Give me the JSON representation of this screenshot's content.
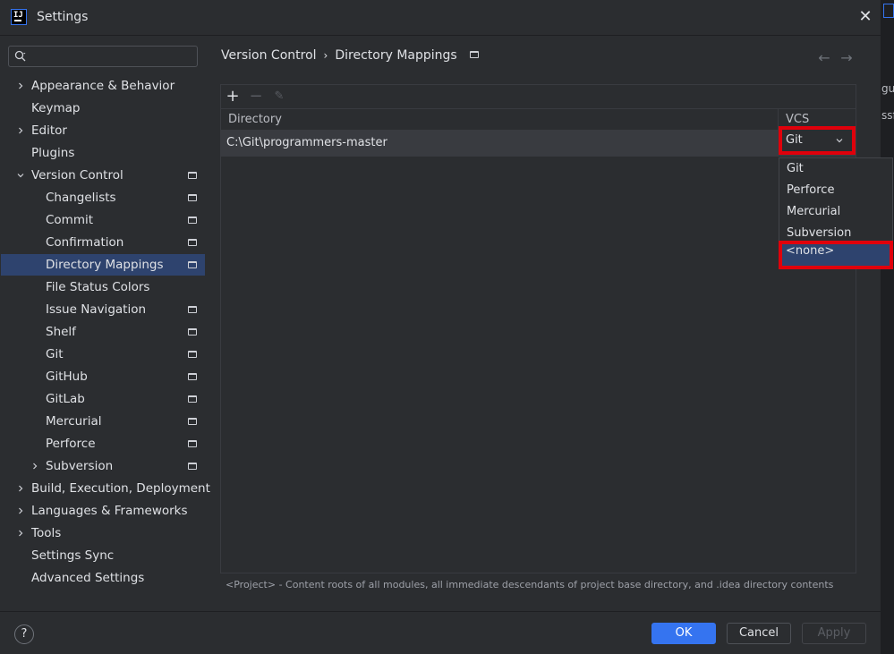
{
  "window": {
    "title": "Settings",
    "app_icon_text": "IJ",
    "close_glyph": "✕"
  },
  "sidebar": {
    "search_placeholder": "",
    "items": [
      {
        "label": "Appearance & Behavior",
        "level": 0,
        "expandable": true,
        "expanded": false,
        "project_icon": false
      },
      {
        "label": "Keymap",
        "level": 0,
        "expandable": false,
        "project_icon": false
      },
      {
        "label": "Editor",
        "level": 0,
        "expandable": true,
        "expanded": false,
        "project_icon": false
      },
      {
        "label": "Plugins",
        "level": 0,
        "expandable": false,
        "project_icon": false
      },
      {
        "label": "Version Control",
        "level": 0,
        "expandable": true,
        "expanded": true,
        "project_icon": true
      },
      {
        "label": "Changelists",
        "level": 1,
        "expandable": false,
        "project_icon": true
      },
      {
        "label": "Commit",
        "level": 1,
        "expandable": false,
        "project_icon": true
      },
      {
        "label": "Confirmation",
        "level": 1,
        "expandable": false,
        "project_icon": true
      },
      {
        "label": "Directory Mappings",
        "level": 1,
        "expandable": false,
        "project_icon": true,
        "selected": true
      },
      {
        "label": "File Status Colors",
        "level": 1,
        "expandable": false,
        "project_icon": false
      },
      {
        "label": "Issue Navigation",
        "level": 1,
        "expandable": false,
        "project_icon": true
      },
      {
        "label": "Shelf",
        "level": 1,
        "expandable": false,
        "project_icon": true
      },
      {
        "label": "Git",
        "level": 1,
        "expandable": false,
        "project_icon": true
      },
      {
        "label": "GitHub",
        "level": 1,
        "expandable": false,
        "project_icon": true
      },
      {
        "label": "GitLab",
        "level": 1,
        "expandable": false,
        "project_icon": true
      },
      {
        "label": "Mercurial",
        "level": 1,
        "expandable": false,
        "project_icon": true
      },
      {
        "label": "Perforce",
        "level": 1,
        "expandable": false,
        "project_icon": true
      },
      {
        "label": "Subversion",
        "level": 1,
        "expandable": true,
        "expanded": false,
        "project_icon": true
      },
      {
        "label": "Build, Execution, Deployment",
        "level": 0,
        "expandable": true,
        "expanded": false,
        "project_icon": false
      },
      {
        "label": "Languages & Frameworks",
        "level": 0,
        "expandable": true,
        "expanded": false,
        "project_icon": false
      },
      {
        "label": "Tools",
        "level": 0,
        "expandable": true,
        "expanded": false,
        "project_icon": false
      },
      {
        "label": "Settings Sync",
        "level": 0,
        "expandable": false,
        "project_icon": false
      },
      {
        "label": "Advanced Settings",
        "level": 0,
        "expandable": false,
        "project_icon": false
      }
    ]
  },
  "breadcrumb": {
    "parent": "Version Control",
    "separator": "›",
    "current": "Directory Mappings"
  },
  "nav": {
    "back": "←",
    "forward": "→"
  },
  "toolbar": {
    "add": "+",
    "remove": "−",
    "edit": "✎"
  },
  "table": {
    "columns": [
      "Directory",
      "VCS"
    ],
    "rows": [
      {
        "directory": "C:\\Git\\programmers-master",
        "vcs": "Git"
      }
    ]
  },
  "vcs_dropdown": {
    "options": [
      "Git",
      "Perforce",
      "Mercurial",
      "Subversion",
      "<none>"
    ],
    "highlighted": "<none>"
  },
  "note": "<Project> - Content roots of all modules, all immediate descendants of project base directory, and .idea directory contents",
  "footer": {
    "help": "?",
    "ok": "OK",
    "cancel": "Cancel",
    "apply": "Apply"
  },
  "background_window": {
    "text1": "gur",
    "text2": "ssf"
  },
  "colors": {
    "background": "#2b2d30",
    "selection": "#2e436e",
    "accent": "#3574f0",
    "highlight_box": "#e0000b"
  }
}
